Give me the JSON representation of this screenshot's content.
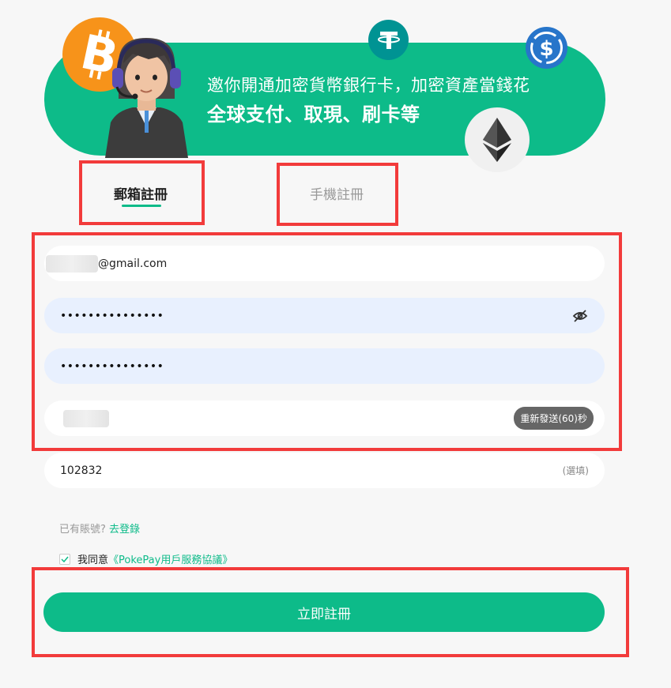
{
  "banner": {
    "line1": "邀你開通加密貨幣銀行卡，加密資產當錢花",
    "line2": "全球支付、取現、刷卡等",
    "coins": [
      "bitcoin-icon",
      "tether-icon",
      "usdc-icon",
      "ethereum-icon"
    ]
  },
  "tabs": {
    "email": "郵箱註冊",
    "phone": "手機註冊",
    "active": "email"
  },
  "form": {
    "email_suffix": "@gmail.com",
    "password": "•••••••••••••••",
    "confirm_password": "•••••••••••••••",
    "resend_label": "重新發送(60)秒",
    "invite_code": "102832",
    "invite_optional": "(選填)"
  },
  "login": {
    "prompt": "已有賬號?",
    "link": "去登錄"
  },
  "agreement": {
    "prefix": "我同意",
    "link": "《PokePay用戶服務協議》",
    "checked": true
  },
  "submit": {
    "label": "立即註冊"
  },
  "colors": {
    "brand": "#0dbb89",
    "annotation": "#f23b3b",
    "field_autofill": "#e8f0fe"
  }
}
